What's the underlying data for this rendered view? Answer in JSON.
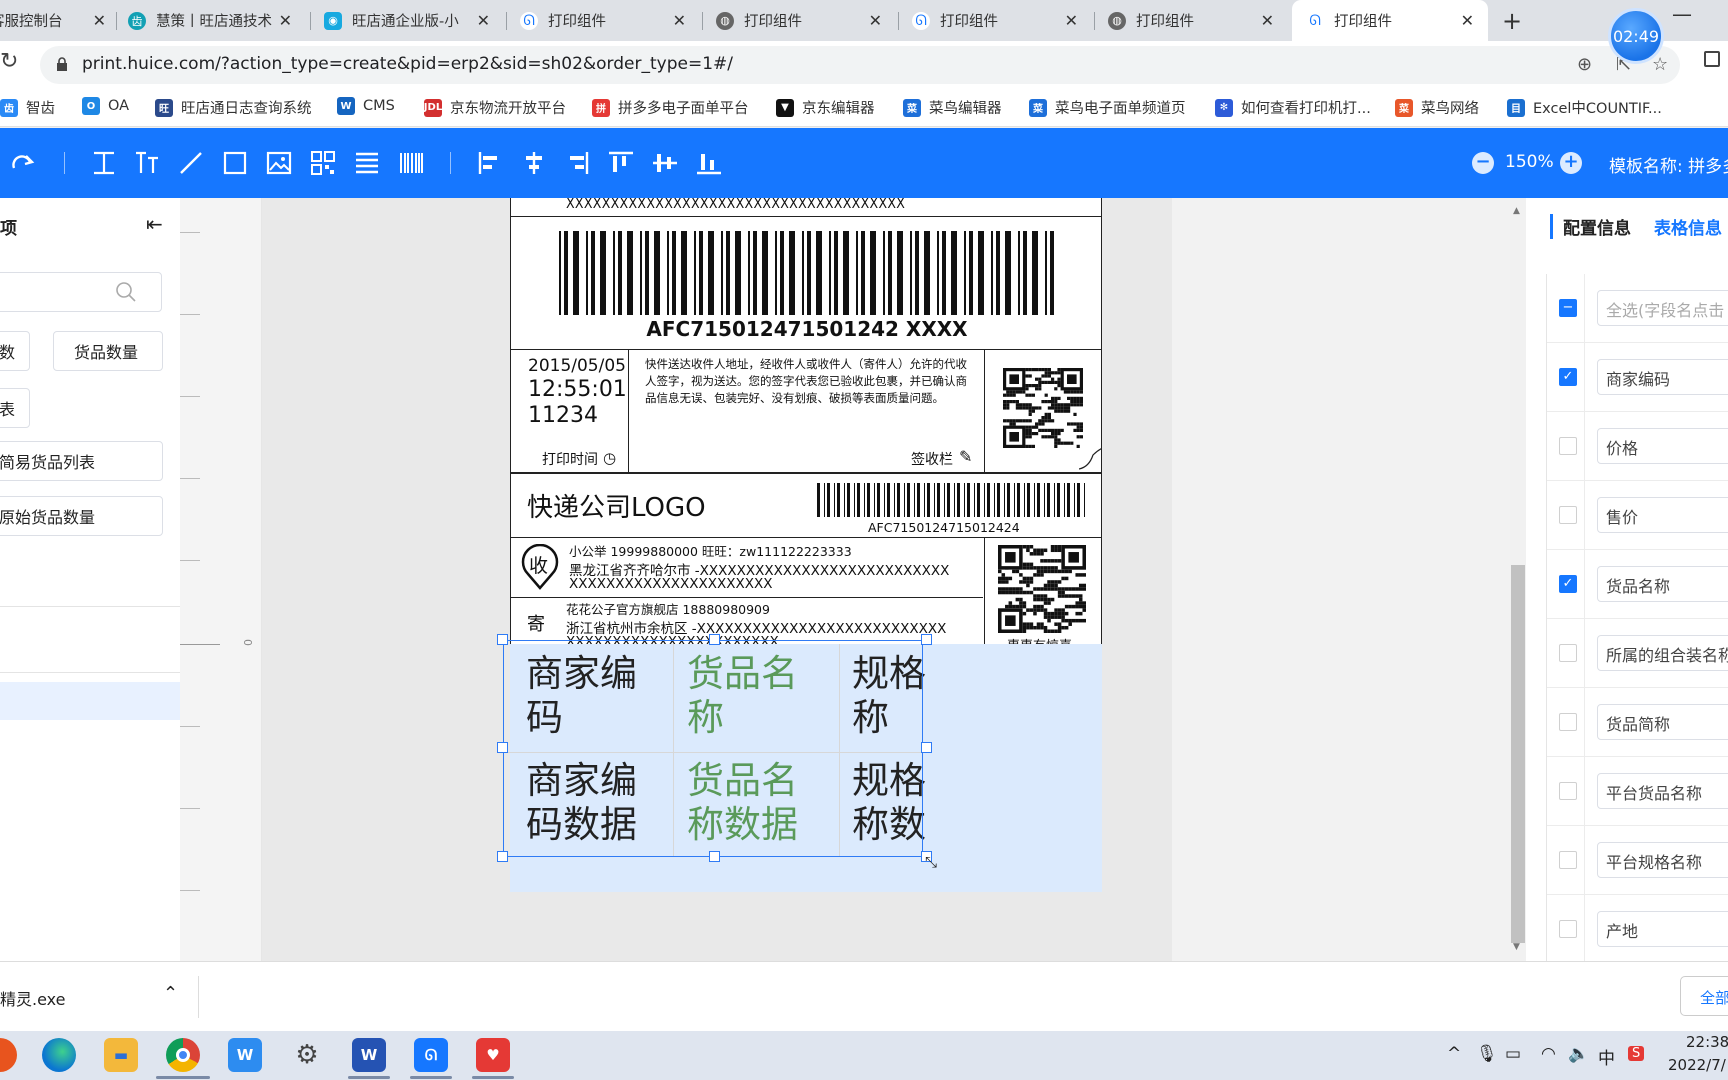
{
  "tabs": [
    {
      "title": "客服控制台",
      "icon": "doc-icon",
      "active": false
    },
    {
      "title": "慧策丨旺店通技术",
      "icon": "tooth-icon",
      "active": false
    },
    {
      "title": "旺店通企业版-小",
      "icon": "robot-icon",
      "active": false
    },
    {
      "title": "打印组件",
      "icon": "huice-icon",
      "active": false
    },
    {
      "title": "打印组件",
      "icon": "globe-icon",
      "active": false
    },
    {
      "title": "打印组件",
      "icon": "huice-icon",
      "active": false
    },
    {
      "title": "打印组件",
      "icon": "globe-icon",
      "active": false
    },
    {
      "title": "打印组件",
      "icon": "huice-icon",
      "active": true
    }
  ],
  "clock_badge": "02:49",
  "address": {
    "url": "print.huice.com/?action_type=create&pid=erp2&sid=sh02&order_type=1#/"
  },
  "bookmarks": [
    {
      "label": "智齿",
      "color": "#2a8af6",
      "glyph": "齿"
    },
    {
      "label": "OA",
      "color": "#1e88e5",
      "glyph": "O"
    },
    {
      "label": "旺店通日志查询系统",
      "color": "#2b4a8b",
      "glyph": "旺"
    },
    {
      "label": "CMS",
      "color": "#1565c0",
      "glyph": "W"
    },
    {
      "label": "京东物流开放平台",
      "color": "#d32f2f",
      "glyph": "JDL"
    },
    {
      "label": "拼多多电子面单平台",
      "color": "#e53935",
      "glyph": "拼"
    },
    {
      "label": "京东编辑器",
      "color": "#111111",
      "glyph": "▼"
    },
    {
      "label": "菜鸟编辑器",
      "color": "#1e6fd9",
      "glyph": "菜"
    },
    {
      "label": "菜鸟电子面单频道页",
      "color": "#1e6fd9",
      "glyph": "菜"
    },
    {
      "label": "如何查看打印机打...",
      "color": "#2d5bd8",
      "glyph": "✻"
    },
    {
      "label": "菜鸟网络",
      "color": "#e8572a",
      "glyph": "菜"
    },
    {
      "label": "Excel中COUNTIF...",
      "color": "#1a6fd0",
      "glyph": "目"
    }
  ],
  "toolbar": {
    "zoom": "150%",
    "template_label": "模板名称: 拼多多"
  },
  "left_panel": {
    "title": "项",
    "buttons": [
      "数",
      "货品数量",
      "表",
      "简易货品列表",
      "原始货品数量"
    ]
  },
  "waybill": {
    "top_x": "XXXXXXXXXXXXXXXXXXXXXXXXXXXXXXXXXXXXXX",
    "barcode_text": "AFC715012471501242 XXXX",
    "date": "2015/05/05",
    "time": "12:55:01",
    "code": "11234",
    "print_time_label": "打印时间",
    "notice": "快件送达收件人地址，经收件人或收件人（寄件人）允许的代收人签字，视为送达。您的签字代表您已验收此包裹，并已确认商品信息无误、包装完好、没有划痕、破损等表面质量问题。",
    "sign_label": "签收栏",
    "courier_logo": "快递公司LOGO",
    "barcode2_text": "AFC7150124715012424",
    "receiver_badge": "收",
    "receiver_line1": "小公举    19999880000    旺旺：zw111122223333",
    "receiver_line2": "黑龙江省齐齐哈尔市 -XXXXXXXXXXXXXXXXXXXXXXXXXXX",
    "receiver_line3": "XXXXXXXXXXXXXXXXXXXXXX",
    "sender_badge": "寄",
    "sender_line1": "花花公子官方旗舰店    18880980909",
    "sender_line2": "浙江省杭州市余杭区 -XXXXXXXXXXXXXXXXXXXXXXXXXXX",
    "sender_line3": "XXXXXXXXXXXXXXXXXXXXXXX",
    "qr_caption": "惠惠有惊喜"
  },
  "table": {
    "headers": [
      "商家编\n码",
      "货品名\n称",
      "规格\n称"
    ],
    "row": [
      "商家编\n码数据",
      "货品名\n称数据",
      "规格\n称数"
    ]
  },
  "right_panel": {
    "tab_config": "配置信息",
    "tab_table": "表格信息",
    "fields": [
      {
        "label": "全选(字段名点击",
        "state": "indeterminate",
        "placeholder": true
      },
      {
        "label": "商家编码",
        "state": "checked"
      },
      {
        "label": "价格",
        "state": "unchecked"
      },
      {
        "label": "售价",
        "state": "unchecked"
      },
      {
        "label": "货品名称",
        "state": "checked"
      },
      {
        "label": "所属的组合装名称",
        "state": "unchecked"
      },
      {
        "label": "货品简称",
        "state": "unchecked"
      },
      {
        "label": "平台货品名称",
        "state": "unchecked"
      },
      {
        "label": "平台规格名称",
        "state": "unchecked"
      },
      {
        "label": "产地",
        "state": "unchecked"
      }
    ]
  },
  "download": {
    "file": "精灵.exe",
    "all_label": "全部"
  },
  "taskbar": {
    "time": "22:38",
    "date": "2022/7/",
    "ime": "中"
  }
}
